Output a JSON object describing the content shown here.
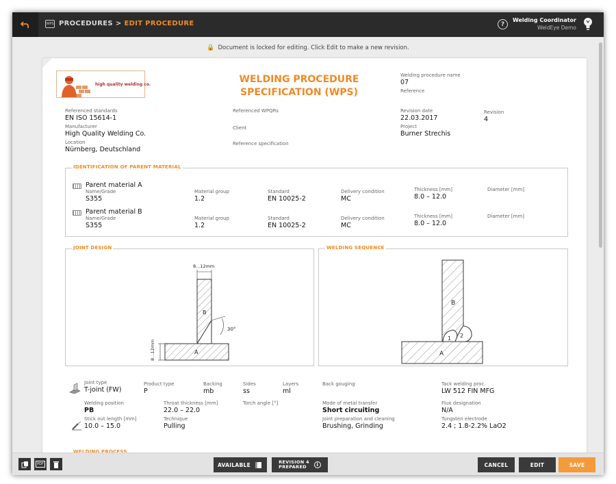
{
  "topbar": {
    "breadcrumb": [
      "PROCEDURES",
      "EDIT PROCEDURE"
    ],
    "breadcrumb_sep": ">",
    "wps_icon_text": "WPS",
    "user_name": "Welding Coordinator",
    "user_org": "WeldEye Demo"
  },
  "notice": "Document is locked for editing. Click Edit to make a new revision.",
  "doc": {
    "logo_text": "high quality welding co.",
    "title_line1": "WELDING PROCEDURE",
    "title_line2": "SPECIFICATION (WPS)",
    "wp_name_label": "Welding procedure name",
    "wp_name_value": "07",
    "reference_label": "Reference",
    "ref_standards_label": "Referenced standards",
    "ref_standards_value": "EN ISO 15614-1",
    "ref_wpqrs_label": "Referenced WPQRs",
    "revision_date_label": "Revision date",
    "revision_date_value": "22.03.2017",
    "revision_label": "Revision",
    "revision_value": "4",
    "manufacturer_label": "Manufacturer",
    "manufacturer_value": "High Quality Welding Co.",
    "client_label": "Client",
    "project_label": "Project",
    "project_value": "Burner Strechis",
    "location_label": "Location",
    "location_value": "Nürnberg, Deutschland",
    "ref_spec_label": "Reference specification"
  },
  "parent_material": {
    "section_title": "IDENTIFICATION OF PARENT MATERIAL",
    "materials": [
      {
        "title": "Parent material A",
        "name_label": "Name/Grade",
        "name_value": "S355",
        "group_label": "Material group",
        "group_value": "1.2",
        "standard_label": "Standard",
        "standard_value": "EN 10025-2",
        "delivery_label": "Delivery condition",
        "delivery_value": "MC",
        "thickness_label": "Thickness [mm]",
        "thickness_value": "8.0 – 12.0",
        "diameter_label": "Diameter [mm]"
      },
      {
        "title": "Parent material B",
        "name_label": "Name/Grade",
        "name_value": "S355",
        "group_label": "Material group",
        "group_value": "1.2",
        "standard_label": "Standard",
        "standard_value": "EN 10025-2",
        "delivery_label": "Delivery condition",
        "delivery_value": "MC",
        "thickness_label": "Thickness [mm]",
        "thickness_value": "8.0 – 12.0",
        "diameter_label": "Diameter [mm]"
      }
    ]
  },
  "joint_design": {
    "section_title": "JOINT DESIGN",
    "dim_top": "8...12mm",
    "dim_side": "8...12mm",
    "angle": "30°",
    "label_a": "A",
    "label_b": "B"
  },
  "welding_sequence": {
    "section_title": "WELDING SEQUENCE",
    "label_a": "A",
    "label_b": "B",
    "pass_1": "1",
    "pass_2": "2"
  },
  "joint_details": {
    "joint_type_label": "Joint type",
    "joint_type_value": "T-joint (FW)",
    "product_type_label": "Product type",
    "product_type_value": "P",
    "backing_label": "Backing",
    "backing_value": "mb",
    "sides_label": "Sides",
    "sides_value": "ss",
    "layers_label": "Layers",
    "layers_value": "ml",
    "back_gouging_label": "Back gouging",
    "tack_label": "Tack welding proc.",
    "tack_value": "LW 512 FIN MFG",
    "position_label": "Welding position",
    "position_value": "PB",
    "throat_label": "Throat thickness [mm]",
    "throat_value": "22.0 – 22.0",
    "torch_label": "Torch angle [°]",
    "transfer_label": "Mode of metal transfer",
    "transfer_value": "Short circuiting",
    "flux_label": "Flux designation",
    "flux_value": "N/A",
    "stickout_label": "Stick out length [mm]",
    "stickout_value": "10.0 – 15.0",
    "technique_label": "Technique",
    "technique_value": "Pulling",
    "prep_label": "Joint preparation and cleaning",
    "prep_value": "Brushing, Grinding",
    "tungsten_label": "Tungsten electrode",
    "tungsten_value": "2.4 ; 1.8-2.2% LaO2"
  },
  "welding_process": {
    "section_title": "WELDING PROCESS"
  },
  "bottombar": {
    "available_label": "AVAILABLE",
    "revision_line1": "REVISION 4",
    "revision_line2": "PREPARED",
    "cancel_label": "CANCEL",
    "edit_label": "EDIT",
    "save_label": "SAVE",
    "pdf_icon_text": "PDF"
  },
  "colors": {
    "accent": "#f08a24",
    "topbar": "#2b2b2b",
    "button_dark": "#3a3a3a",
    "save": "#f39a3b"
  },
  "icons": [
    "back-arrow-icon",
    "wps-icon",
    "help-icon",
    "lightbulb-icon",
    "lock-icon",
    "material-icon",
    "joint-type-icon",
    "torch-icon",
    "copy-icon",
    "pdf-icon",
    "trash-icon",
    "document-icon",
    "info-icon"
  ]
}
